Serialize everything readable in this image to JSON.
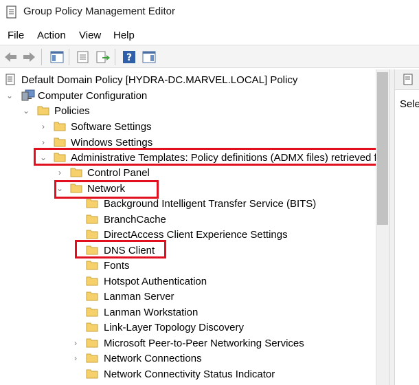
{
  "window": {
    "title": "Group Policy Management Editor"
  },
  "menu": [
    "File",
    "Action",
    "View",
    "Help"
  ],
  "toolbar": [
    {
      "icon": "back-arrow-icon"
    },
    {
      "icon": "forward-arrow-icon"
    },
    {
      "icon": "show-hide-tree-icon"
    },
    {
      "icon": "properties-icon"
    },
    {
      "icon": "export-list-icon"
    },
    {
      "icon": "help-icon"
    },
    {
      "icon": "show-action-pane-icon"
    }
  ],
  "tree": {
    "root": "Default Domain Policy [HYDRA-DC.MARVEL.LOCAL] Policy",
    "computer_config": "Computer Configuration",
    "policies": "Policies",
    "software_settings": "Software Settings",
    "windows_settings": "Windows Settings",
    "admin_templates": "Administrative Templates: Policy definitions (ADMX files) retrieved fro",
    "control_panel": "Control Panel",
    "network": "Network",
    "network_children": [
      "Background Intelligent Transfer Service (BITS)",
      "BranchCache",
      "DirectAccess Client Experience Settings",
      "DNS Client",
      "Fonts",
      "Hotspot Authentication",
      "Lanman Server",
      "Lanman Workstation",
      "Link-Layer Topology Discovery",
      "Microsoft Peer-to-Peer Networking Services",
      "Network Connections",
      "Network Connectivity Status Indicator"
    ]
  },
  "right_pane": {
    "text": "Select"
  },
  "colors": {
    "highlight": "#e0101e",
    "folder": "#f6d16b"
  }
}
